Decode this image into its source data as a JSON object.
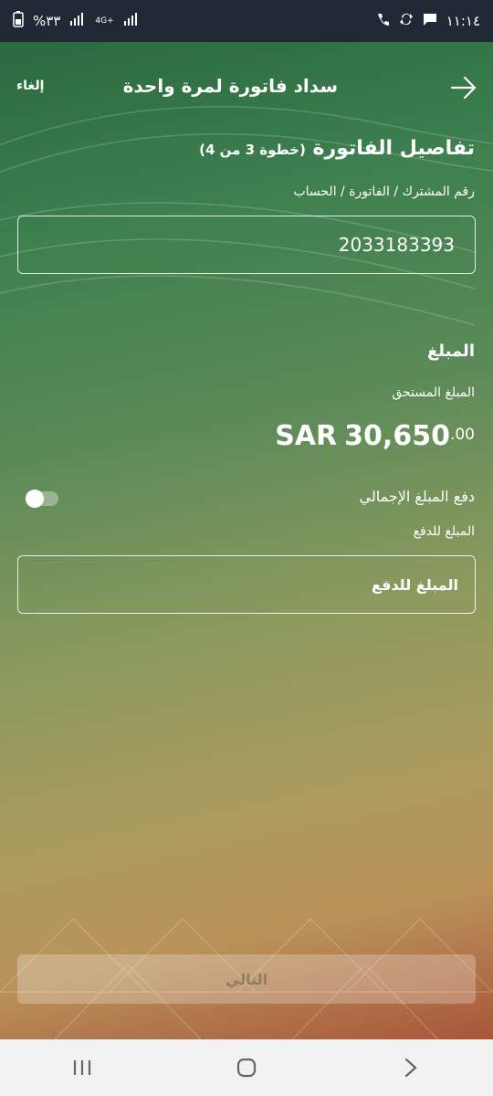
{
  "status_bar": {
    "battery": "%٣٣",
    "signal_tech": "4G+",
    "time": "١١:١٤"
  },
  "header": {
    "title": "سداد فاتورة لمرة واحدة",
    "cancel_label": "إلغاء"
  },
  "invoice_details": {
    "title": "تفاصيل الفاتورة",
    "step": "(خطوة 3 من 4)",
    "account_label": "رقم المشترك / الفاتورة / الحساب",
    "account_value": "2033183393"
  },
  "amount": {
    "section_title": "المبلغ",
    "due_label": "المبلغ المستحق",
    "currency": "SAR",
    "value": "30,650",
    "decimals": ".00",
    "pay_total_label": "دفع المبلغ الإجمالي",
    "pay_total_enabled": false,
    "pay_amount_label": "المبلغ للدفع",
    "pay_amount_placeholder": "المبلغ للدفع"
  },
  "footer": {
    "next_label": "التالي"
  },
  "colors": {
    "gradient_top": "#2a6a3f",
    "gradient_mid": "#ae9b5f",
    "gradient_bottom": "#a8563a",
    "status_bar": "#1f2a36",
    "nav_bar": "#f2f2f2"
  }
}
